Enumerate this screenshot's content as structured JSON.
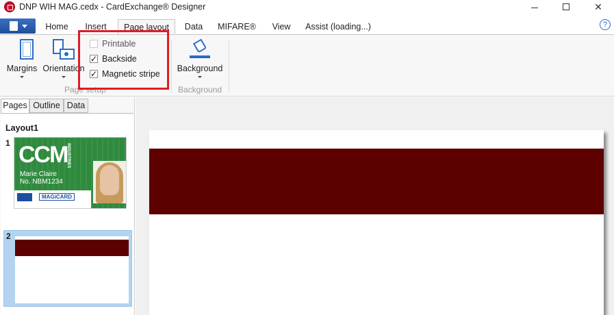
{
  "window": {
    "title": "DNP WIH MAG.cedx - CardExchange® Designer",
    "minimize": "",
    "close_glyph": "✕"
  },
  "ribbon_tabs": [
    {
      "label": "Home"
    },
    {
      "label": "Insert"
    },
    {
      "label": "Page layout",
      "active": true
    },
    {
      "label": "Data"
    },
    {
      "label": "MIFARE®"
    },
    {
      "label": "View"
    },
    {
      "label": "Assist (loading...)"
    }
  ],
  "help_glyph": "?",
  "page_setup": {
    "margins_label": "Margins",
    "orientation_label": "Orientation",
    "checkboxes": [
      {
        "label": "Printable",
        "checked": false,
        "enabled": false
      },
      {
        "label": "Backside",
        "checked": true,
        "enabled": true
      },
      {
        "label": "Magnetic stripe",
        "checked": true,
        "enabled": true
      }
    ],
    "check_glyph": "✓",
    "group_label": "Page setup"
  },
  "background_group": {
    "button_label": "Background",
    "group_label": "Background"
  },
  "left_pane": {
    "tabs": [
      {
        "label": "Pages",
        "active": true
      },
      {
        "label": "Outline"
      },
      {
        "label": "Data"
      }
    ],
    "layout_title": "Layout1",
    "pages": [
      {
        "number": "1"
      },
      {
        "number": "2",
        "selected": true
      }
    ],
    "thumbnail1": {
      "brand": "CCM",
      "brand_side": "INDUSTRIES",
      "name": "Marie Claire",
      "id": "No. NBM1234",
      "logo": "MAGiCARD"
    }
  },
  "colors": {
    "magnetic_stripe": "#5c0000",
    "accent": "#2b6cc4",
    "highlight": "#e01b24",
    "selection": "#b3d4f0"
  }
}
